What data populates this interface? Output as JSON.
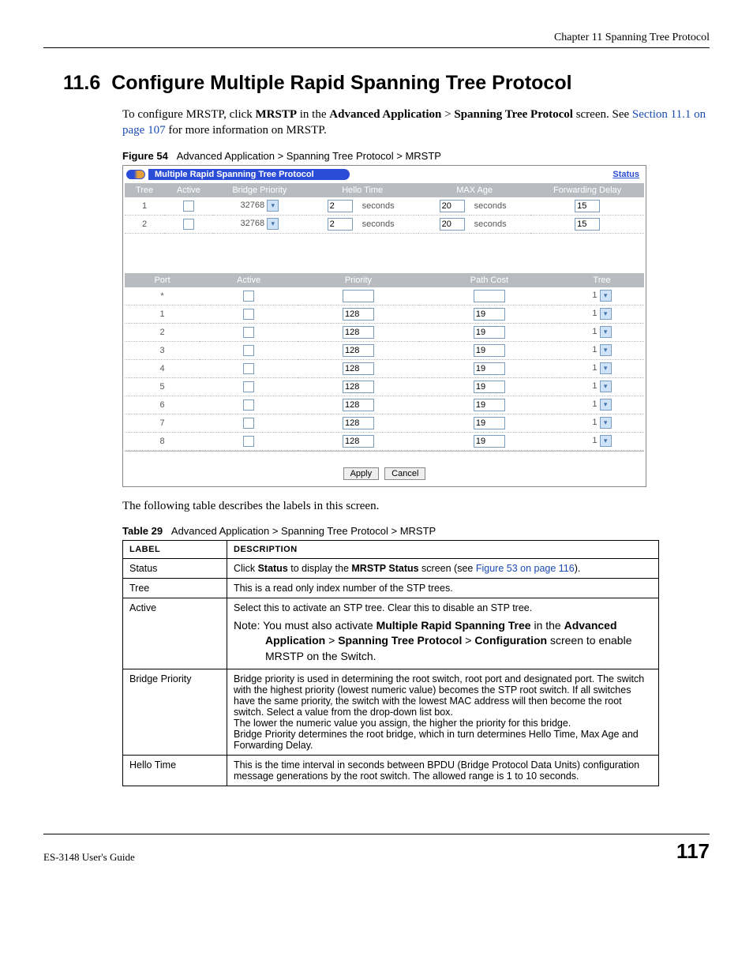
{
  "header": {
    "chapter": "Chapter 11 Spanning Tree Protocol"
  },
  "section": {
    "number": "11.6",
    "title": "Configure Multiple Rapid Spanning Tree Protocol"
  },
  "intro": {
    "pre": "To configure MRSTP, click ",
    "mrstp": "MRSTP",
    "mid": " in the ",
    "advapp": "Advanced Application",
    "gt": " > ",
    "stp": "Spanning Tree Protocol",
    "after_stp": " screen. See ",
    "link": "Section 11.1 on page 107",
    "tail": " for more information on MRSTP."
  },
  "figure": {
    "label": "Figure 54",
    "caption": "Advanced Application > Spanning Tree Protocol > MRSTP",
    "panel_title": "Multiple Rapid Spanning Tree Protocol",
    "status_link": "Status",
    "tree_headers": [
      "Tree",
      "Active",
      "Bridge Priority",
      "Hello Time",
      "MAX Age",
      "Forwarding Delay"
    ],
    "seconds_label": "seconds",
    "trees": [
      {
        "tree": "1",
        "priority": "32768",
        "hello": "2",
        "maxage": "20",
        "fwd": "15"
      },
      {
        "tree": "2",
        "priority": "32768",
        "hello": "2",
        "maxage": "20",
        "fwd": "15"
      }
    ],
    "port_headers": [
      "Port",
      "Active",
      "Priority",
      "Path Cost",
      "Tree"
    ],
    "ports": [
      {
        "port": "*",
        "priority": "",
        "path": "",
        "tree": "1"
      },
      {
        "port": "1",
        "priority": "128",
        "path": "19",
        "tree": "1"
      },
      {
        "port": "2",
        "priority": "128",
        "path": "19",
        "tree": "1"
      },
      {
        "port": "3",
        "priority": "128",
        "path": "19",
        "tree": "1"
      },
      {
        "port": "4",
        "priority": "128",
        "path": "19",
        "tree": "1"
      },
      {
        "port": "5",
        "priority": "128",
        "path": "19",
        "tree": "1"
      },
      {
        "port": "6",
        "priority": "128",
        "path": "19",
        "tree": "1"
      },
      {
        "port": "7",
        "priority": "128",
        "path": "19",
        "tree": "1"
      },
      {
        "port": "8",
        "priority": "128",
        "path": "19",
        "tree": "1"
      }
    ],
    "apply": "Apply",
    "cancel": "Cancel"
  },
  "following": "The following table describes the labels in this screen.",
  "table29": {
    "label": "Table 29",
    "caption": "Advanced Application > Spanning Tree Protocol > MRSTP",
    "head_label": "LABEL",
    "head_desc": "DESCRIPTION",
    "rows": {
      "status": {
        "l": "Status",
        "p1": "Click ",
        "b1": "Status",
        "p2": " to display the ",
        "b2": "MRSTP Status",
        "p3": " screen (see ",
        "link": "Figure 53 on page 116",
        "p4": ")."
      },
      "tree": {
        "l": "Tree",
        "d": "This is a read only index number of the STP trees."
      },
      "active": {
        "l": "Active",
        "d": "Select this to activate an STP tree. Clear this to disable an STP tree.",
        "note_pre": "Note: You must also activate ",
        "note_b1": "Multiple Rapid Spanning Tree",
        "note_m1": " in the ",
        "note_b2": "Advanced Application",
        "note_gt1": " > ",
        "note_b3": "Spanning Tree Protocol",
        "note_gt2": " > ",
        "note_b4": "Configuration",
        "note_tail": " screen to enable MRSTP on the Switch."
      },
      "bridge": {
        "l": "Bridge Priority",
        "p1": "Bridge priority is used in determining the root switch, root port and designated port. The switch with the highest priority (lowest numeric value) becomes the STP root switch. If all switches have the same priority, the switch with the lowest MAC address will then become the root switch. Select a value from the drop-down list box.",
        "p2": "The lower the numeric value you assign, the higher the priority for this bridge.",
        "p3": "Bridge Priority determines the root bridge, which in turn determines Hello Time, Max Age and Forwarding Delay."
      },
      "hello": {
        "l": "Hello Time",
        "d": "This is the time interval in seconds between BPDU (Bridge Protocol Data Units) configuration message generations by the root switch. The allowed range is 1 to 10 seconds."
      }
    }
  },
  "footer": {
    "guide": "ES-3148 User's Guide",
    "page": "117"
  }
}
